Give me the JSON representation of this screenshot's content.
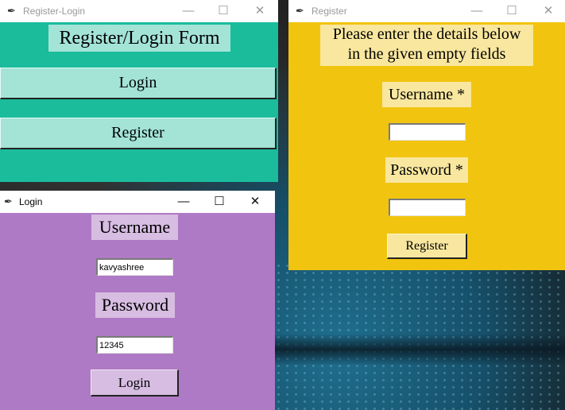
{
  "window_controls": {
    "minimize": "—",
    "maximize": "☐",
    "close": "✕"
  },
  "register_login_window": {
    "title": "Register-Login",
    "heading": "Register/Login Form",
    "login_button": "Login",
    "register_button": "Register"
  },
  "register_window": {
    "title": "Register",
    "info_line1": "Please enter the details below",
    "info_line2": "in the given empty fields",
    "username_label": "Username *",
    "username_value": "",
    "password_label": "Password *",
    "password_value": "",
    "register_button": "Register"
  },
  "login_window": {
    "title": "Login",
    "username_label": "Username",
    "username_value": "kavyashree",
    "password_label": "Password",
    "password_value": "12345",
    "login_button": "Login"
  },
  "colors": {
    "register_login_bg": "#1abc9c",
    "register_bg": "#f1c40f",
    "login_bg": "#af7ac5"
  }
}
